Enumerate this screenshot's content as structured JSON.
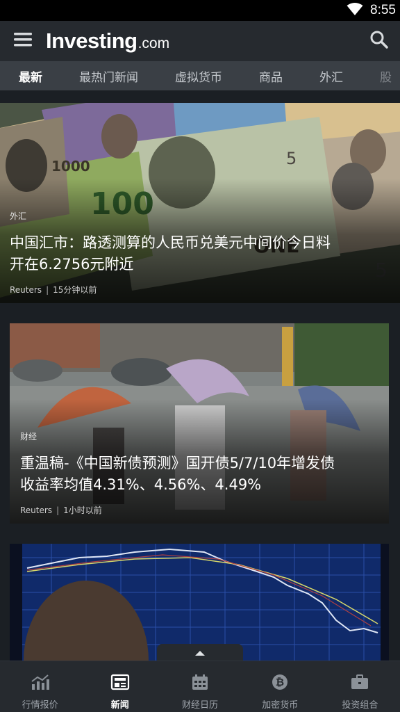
{
  "status_bar": {
    "time": "8:55",
    "icons": [
      "wifi-icon",
      "battery-icon"
    ]
  },
  "app_bar": {
    "brand": "Investing",
    "domain_suffix": ".com",
    "icons": [
      "menu-icon",
      "search-icon"
    ]
  },
  "tabs": [
    {
      "label": "最新",
      "active": true
    },
    {
      "label": "最热门新闻",
      "active": false
    },
    {
      "label": "虚拟货币",
      "active": false
    },
    {
      "label": "商品",
      "active": false
    },
    {
      "label": "外汇",
      "active": false
    },
    {
      "label": "股",
      "active": false
    }
  ],
  "articles": [
    {
      "category": "外汇",
      "headline_line1": "中国汇市：路透测算的人民币兑美元中间价今日料",
      "headline_line2": "开在6.2756元附近",
      "source": "Reuters",
      "separator": "|",
      "time_ago": "15分钟以前"
    },
    {
      "category": "财经",
      "headline_line1": "重温稿-《中国新债预测》国开债5/7/10年增发债",
      "headline_line2": "收益率均值4.31%、4.56%、4.49%",
      "source": "Reuters",
      "separator": "|",
      "time_ago": "1小时以前"
    }
  ],
  "bottom_nav": [
    {
      "label": "行情报价",
      "icon": "chart-icon",
      "active": false
    },
    {
      "label": "新闻",
      "icon": "newspaper-icon",
      "active": true
    },
    {
      "label": "财经日历",
      "icon": "calendar-icon",
      "active": false
    },
    {
      "label": "加密货币",
      "icon": "bitcoin-icon",
      "active": false
    },
    {
      "label": "投资组合",
      "icon": "briefcase-icon",
      "active": false
    }
  ],
  "colors": {
    "app_bar": "#262a2f",
    "tab_bar": "#3a3f45",
    "background": "#1b1f24",
    "active_text": "#ffffff",
    "inactive_text": "#9ea4ab"
  }
}
